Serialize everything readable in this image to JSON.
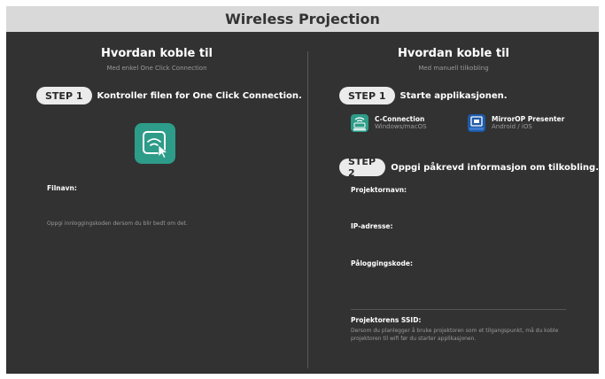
{
  "window": {
    "title": "Wireless Projection"
  },
  "left": {
    "heading": "Hvordan koble til",
    "subheading": "Med enkel One Click Connection",
    "step_badge": "STEP 1",
    "step_text": "Kontroller filen for One Click Connection.",
    "icon": "one-click-connection-icon",
    "filename_label": "Filnavn:",
    "hint": "Oppgi innloggingskoden dersom du blir bedt om det."
  },
  "right": {
    "heading": "Hvordan koble til",
    "subheading": "Med manuell tilkobling",
    "step1_badge": "STEP 1",
    "step1_text": "Starte applikasjonen.",
    "apps": [
      {
        "name": "C-Connection",
        "platform": "Windows/macOS",
        "icon": "c-connection-icon"
      },
      {
        "name": "MirrorOP Presenter",
        "platform": "Android / iOS",
        "icon": "mirrorop-icon"
      }
    ],
    "step2_badge": "STEP 2",
    "step2_text": "Oppgi påkrevd informasjon om tilkobling.",
    "fields": {
      "projector_name": "Projektornavn:",
      "ip_address": "IP-adresse:",
      "login_code": "Påloggingskode:"
    },
    "ssid_label": "Projektorens SSID:",
    "ssid_hint": "Dersom du planlegger å bruke projektoren som et tilgangspunkt, må du koble projektoren til wifi før du starter applikasjonen."
  },
  "colors": {
    "titlebar_bg": "#d9d9d9",
    "panel_bg": "#323232",
    "pill_bg": "#ebebeb",
    "accent_teal": "#2d9c89",
    "mirrorop_blue": "#1e5aa8"
  }
}
